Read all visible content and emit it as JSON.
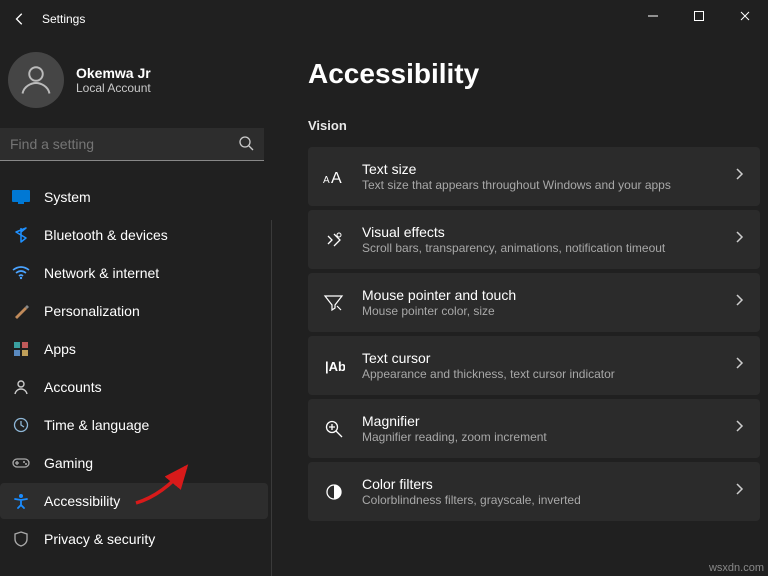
{
  "titlebar": {
    "app_title": "Settings"
  },
  "profile": {
    "name": "Okemwa Jr",
    "sub": "Local Account"
  },
  "search": {
    "placeholder": "Find a setting"
  },
  "nav": {
    "items": [
      {
        "label": "System",
        "icon": "system",
        "selected": false
      },
      {
        "label": "Bluetooth & devices",
        "icon": "bluetooth",
        "selected": false
      },
      {
        "label": "Network & internet",
        "icon": "network",
        "selected": false
      },
      {
        "label": "Personalization",
        "icon": "personalization",
        "selected": false
      },
      {
        "label": "Apps",
        "icon": "apps",
        "selected": false
      },
      {
        "label": "Accounts",
        "icon": "accounts",
        "selected": false
      },
      {
        "label": "Time & language",
        "icon": "time",
        "selected": false
      },
      {
        "label": "Gaming",
        "icon": "gaming",
        "selected": false
      },
      {
        "label": "Accessibility",
        "icon": "accessibility",
        "selected": true
      },
      {
        "label": "Privacy & security",
        "icon": "privacy",
        "selected": false
      }
    ]
  },
  "page": {
    "title": "Accessibility",
    "section": "Vision",
    "cards": [
      {
        "title": "Text size",
        "sub": "Text size that appears throughout Windows and your apps"
      },
      {
        "title": "Visual effects",
        "sub": "Scroll bars, transparency, animations, notification timeout"
      },
      {
        "title": "Mouse pointer and touch",
        "sub": "Mouse pointer color, size"
      },
      {
        "title": "Text cursor",
        "sub": "Appearance and thickness, text cursor indicator"
      },
      {
        "title": "Magnifier",
        "sub": "Magnifier reading, zoom increment"
      },
      {
        "title": "Color filters",
        "sub": "Colorblindness filters, grayscale, inverted"
      }
    ]
  },
  "watermark": "wsxdn.com",
  "colors": {
    "accent_blue": "#0078d4",
    "arrow_red": "#d81a1a"
  }
}
